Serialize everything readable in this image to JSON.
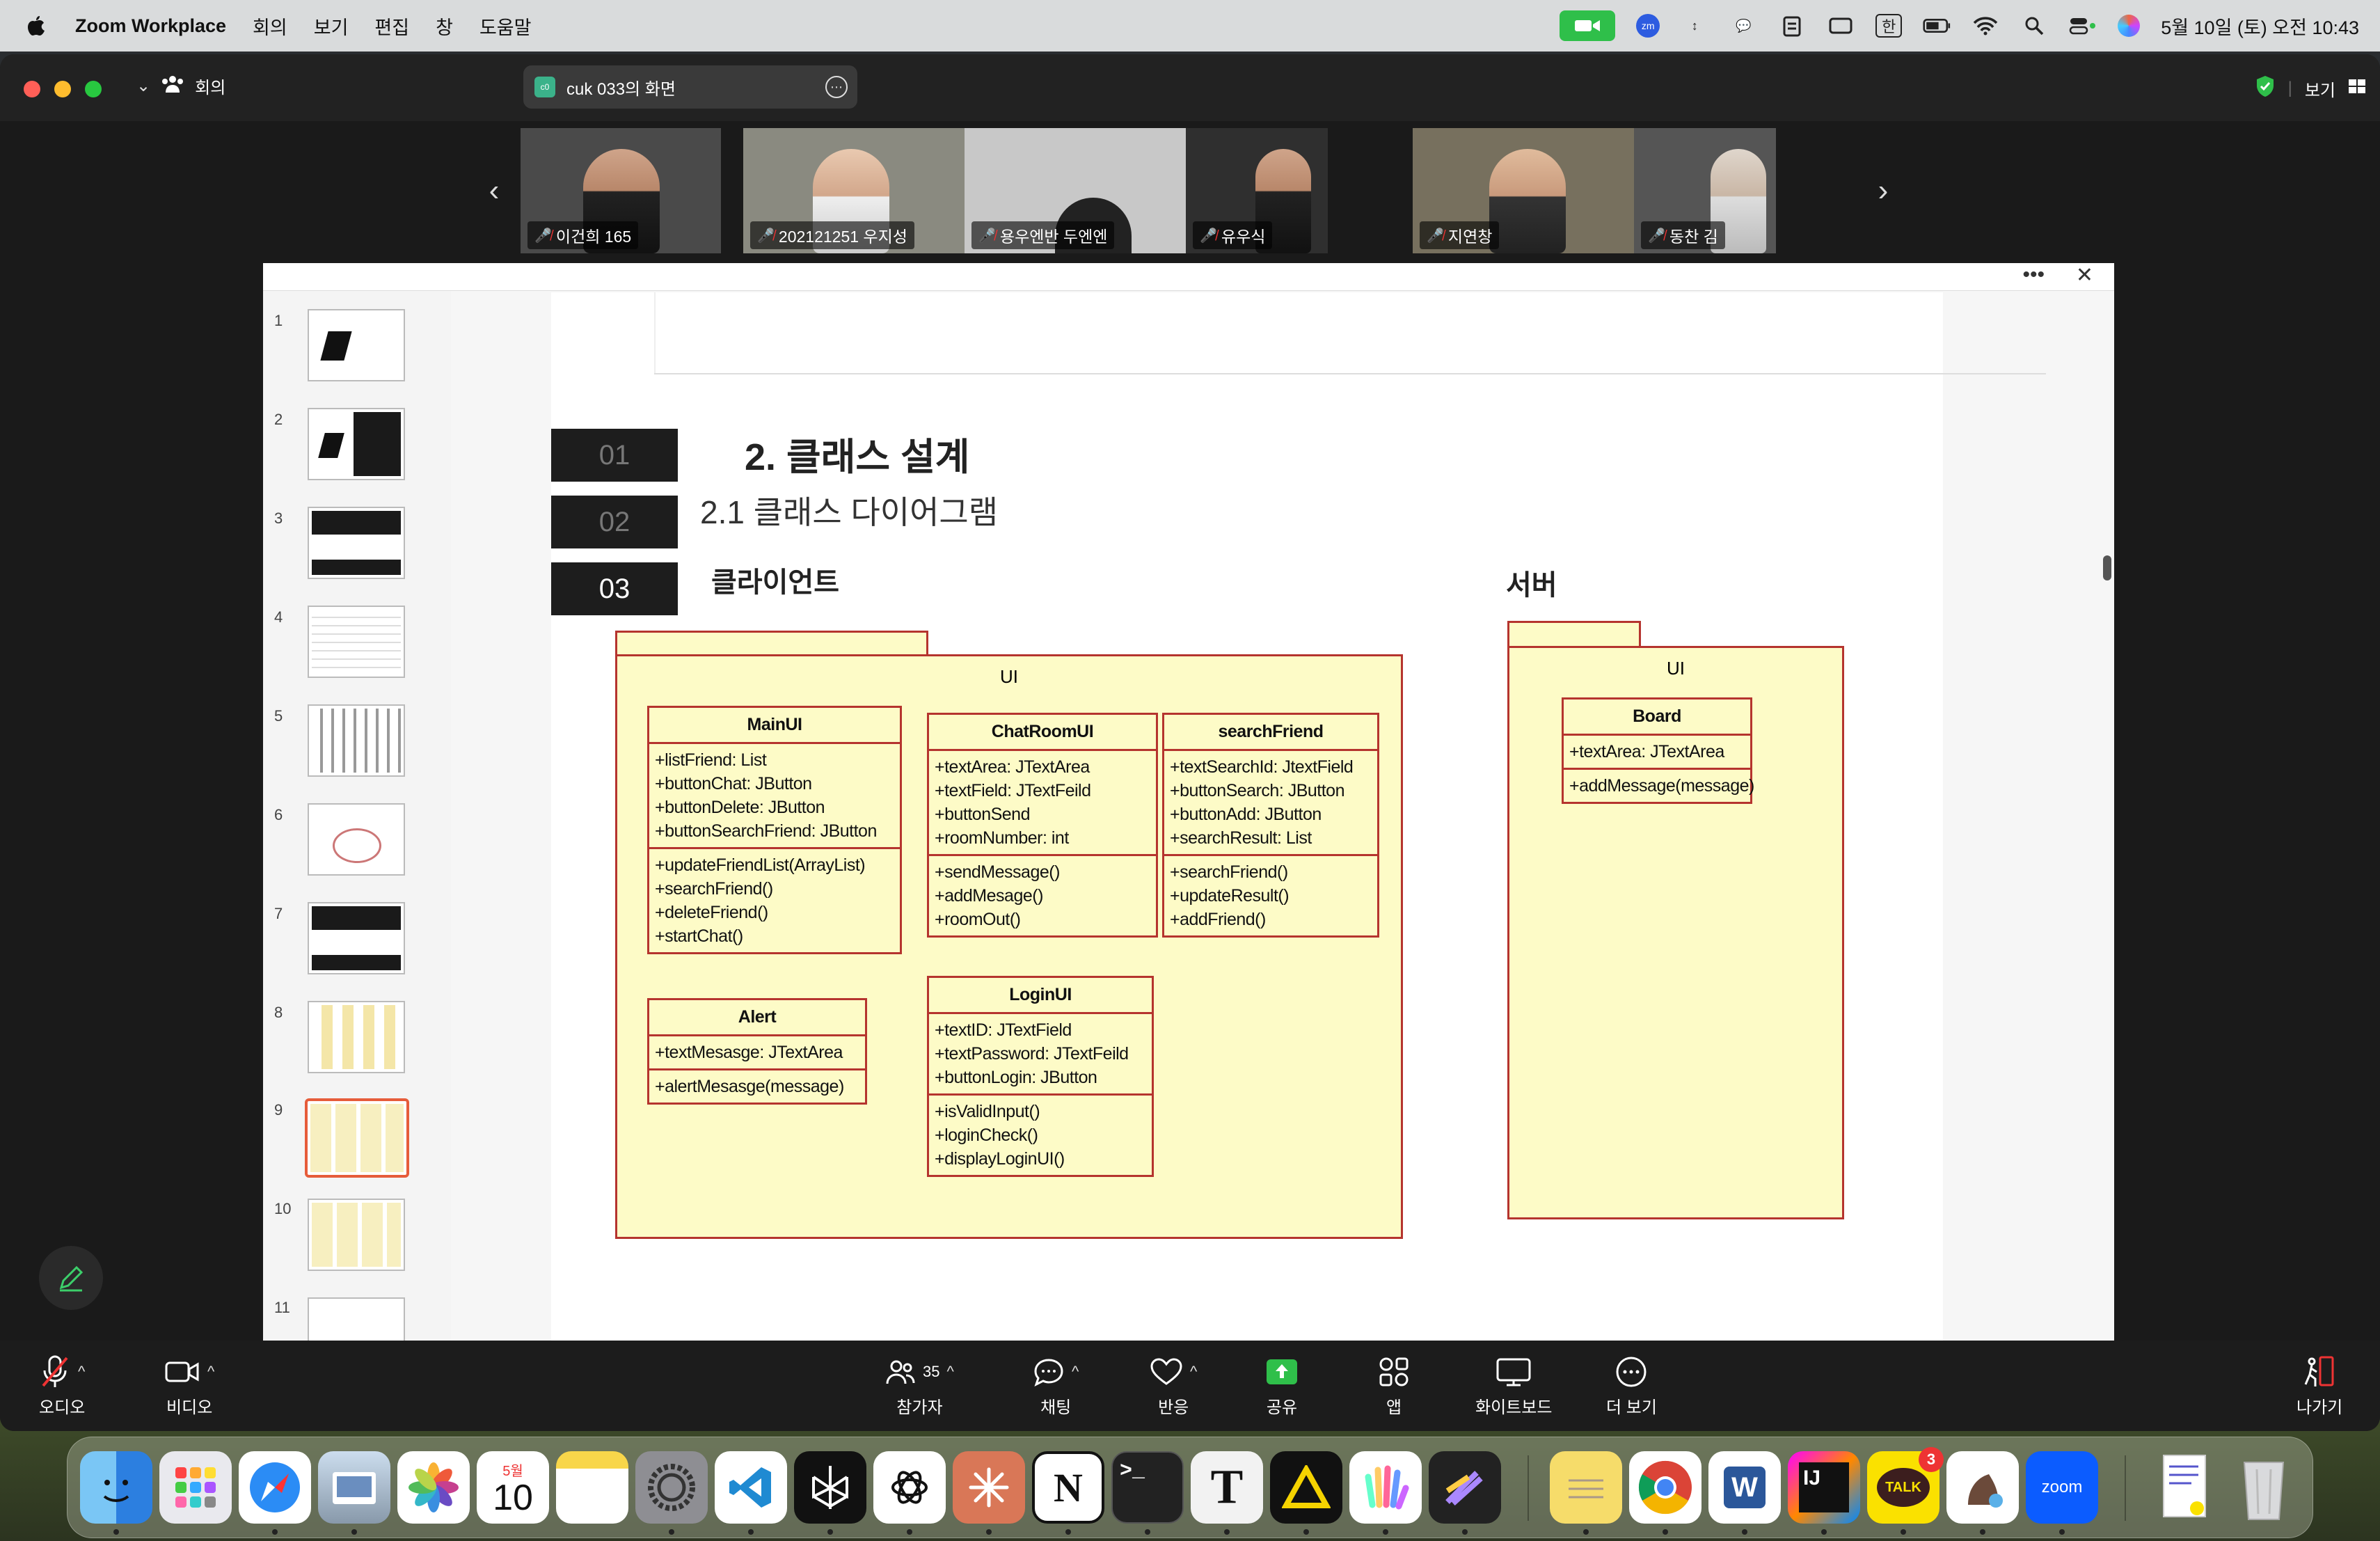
{
  "menubar": {
    "app_name": "Zoom Workplace",
    "menus": [
      "회의",
      "보기",
      "편집",
      "창",
      "도움말"
    ],
    "ime": "한",
    "datetime": "5월 10일 (토) 오전 10:43"
  },
  "window": {
    "meeting_label": "회의",
    "share_title": "cuk 033의 화면",
    "share_badge": "c0",
    "view_label": "보기"
  },
  "participants": [
    "이건희 165",
    "202121251 우지성",
    "용우엔반 두엔엔",
    "유우식",
    "지연창",
    "동찬 김"
  ],
  "thumbnails": [
    "1",
    "2",
    "3",
    "4",
    "5",
    "6",
    "7",
    "8",
    "9",
    "10",
    "11"
  ],
  "slide": {
    "tabs": [
      "01",
      "02",
      "03"
    ],
    "title": "2. 클래스 설계",
    "subtitle": "2.1 클래스 다이어그램",
    "client_heading": "클라이언트",
    "server_heading": "서버",
    "client_package": "UI",
    "server_package": "UI",
    "classes": {
      "mainui": {
        "name": "MainUI",
        "attrs": [
          "+listFriend: List",
          "+buttonChat: JButton",
          "+buttonDelete: JButton",
          "+buttonSearchFriend: JButton"
        ],
        "ops": [
          "+updateFriendList(ArrayList)",
          "+searchFriend()",
          "+deleteFriend()",
          "+startChat()"
        ]
      },
      "chatroomui": {
        "name": "ChatRoomUI",
        "attrs": [
          "+textArea: JTextArea",
          "+textField: JTextFeild",
          "+buttonSend",
          "+roomNumber: int"
        ],
        "ops": [
          "+sendMessage()",
          "+addMesage()",
          "+roomOut()"
        ]
      },
      "searchfriend": {
        "name": "searchFriend",
        "attrs": [
          "+textSearchId: JtextField",
          "+buttonSearch: JButton",
          "+buttonAdd: JButton",
          "+searchResult: List"
        ],
        "ops": [
          "+searchFriend()",
          "+updateResult()",
          "+addFriend()"
        ]
      },
      "alert": {
        "name": "Alert",
        "attrs": [
          "+textMesasge: JTextArea"
        ],
        "ops": [
          "+alertMesasge(message)"
        ]
      },
      "loginui": {
        "name": "LoginUI",
        "attrs": [
          "+textID: JTextField",
          "+textPassword: JTextFeild",
          "+buttonLogin: JButton"
        ],
        "ops": [
          "+isValidInput()",
          "+loginCheck()",
          "+displayLoginUI()"
        ]
      },
      "board": {
        "name": "Board",
        "attrs": [
          "+textArea: JTextArea"
        ],
        "ops": [
          "+addMessage(message)"
        ]
      }
    }
  },
  "toolbar": {
    "audio": "오디오",
    "video": "비디오",
    "participants": "참가자",
    "participants_count": "35",
    "chat": "채팅",
    "reactions": "반응",
    "share": "공유",
    "apps": "앱",
    "whiteboard": "화이트보드",
    "more": "더 보기",
    "leave": "나가기"
  },
  "dock": {
    "calendar_month": "5월",
    "calendar_day": "10",
    "kakao_badge": "3",
    "kakao_label": "TALK",
    "zoom_label": "zoom",
    "intellij_label": "IJ",
    "word_label": "W",
    "notion_label": "N",
    "typora_label": "T"
  },
  "colors": {
    "uml_fill": "#fdfbc7",
    "uml_border": "#b5342e",
    "selected_thumb": "#e65c3a",
    "video_green": "#2fbf4a",
    "zoom_blue": "#0b5cff"
  }
}
